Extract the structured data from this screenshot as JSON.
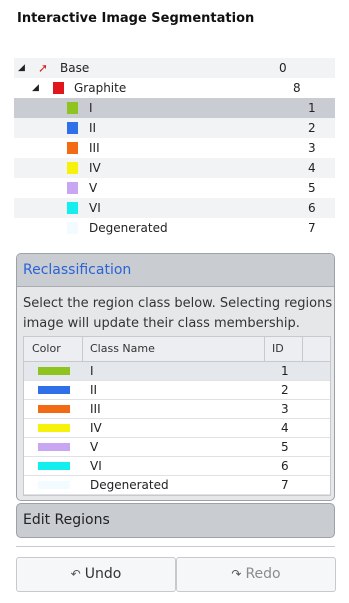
{
  "title": "Interactive Image Segmentation",
  "tree": {
    "root": {
      "label": "Base",
      "id": "0"
    },
    "group": {
      "label": "Graphite",
      "id": "8",
      "color": "#e0161c"
    },
    "classes": [
      {
        "label": "I",
        "id": "1",
        "color": "#8fc31f"
      },
      {
        "label": "II",
        "id": "2",
        "color": "#2f6fe8"
      },
      {
        "label": "III",
        "id": "3",
        "color": "#f26a14"
      },
      {
        "label": "IV",
        "id": "4",
        "color": "#f7f20c"
      },
      {
        "label": "V",
        "id": "5",
        "color": "#c8a6f2"
      },
      {
        "label": "VI",
        "id": "6",
        "color": "#14eeee"
      },
      {
        "label": "Degenerated",
        "id": "7",
        "color": "#f2fbff"
      }
    ]
  },
  "reclass": {
    "title": "Reclassification",
    "desc_line1": "Select the region class below. Selecting regions in",
    "desc_line2": "image will update their class membership.",
    "headers": {
      "color": "Color",
      "class_name": "Class Name",
      "id": "ID"
    }
  },
  "edit_regions": "Edit Regions",
  "buttons": {
    "undo": "Undo",
    "redo": "Redo"
  },
  "icons": {
    "undo": "undo-icon",
    "redo": "redo-icon",
    "up": "up-arrow-icon"
  }
}
